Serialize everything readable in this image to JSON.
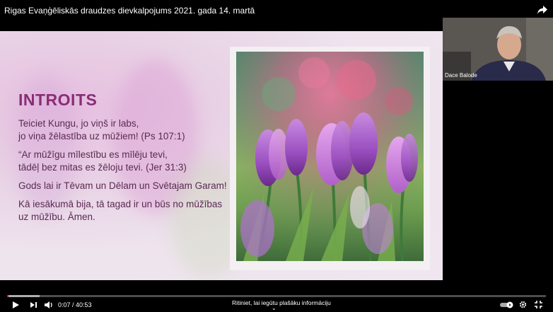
{
  "video": {
    "title": "Rigas Evaņģēliskās draudzes dievkalpojums 2021. gada 14. martā",
    "current_time": "0:07",
    "separator": " / ",
    "duration": "40:53",
    "progress_fraction": 0.003,
    "scroll_hint": "Ritiniet, lai iegūtu plašāku informāciju"
  },
  "slide": {
    "heading": "INTROITS",
    "paragraphs": [
      [
        "Teiciet Kungu, jo viņš ir labs,",
        "jo viņa žēlastība uz mūžiem!  (Ps 107:1)"
      ],
      [
        "“Ar mūžīgu mīlestību es mīlēju tevi,",
        "tādēļ bez mitas es žēloju tevi.  (Jer 31:3)"
      ],
      [
        "Gods lai ir Tēvam un Dēlam un Svētajam Garam!"
      ],
      [
        "Kā iesākumā bija, tā tagad ir un būs no mūžības",
        "uz mūžību. Āmen."
      ]
    ]
  },
  "participant": {
    "name": "Dace Balode"
  },
  "icons": {
    "share": "share-icon",
    "play": "play-icon",
    "next": "next-icon",
    "volume": "volume-icon",
    "autoplay": "autoplay-toggle-icon",
    "settings": "gear-icon",
    "fullscreen": "exit-fullscreen-icon"
  },
  "colors": {
    "heading": "#8a2d76",
    "body_text": "#5a2a52",
    "progress": "#ff0000"
  }
}
